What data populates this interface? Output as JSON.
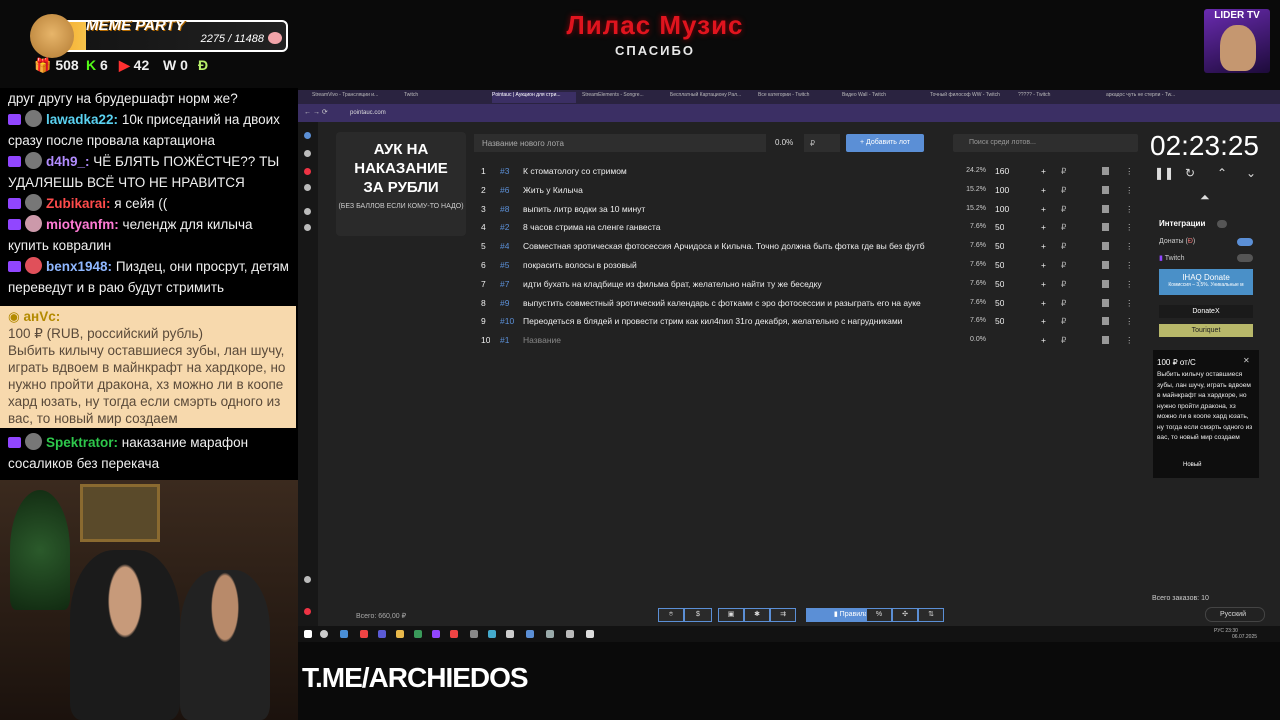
{
  "banner": {
    "title": "Лилас Музис",
    "subtitle": "СПАСИБО"
  },
  "meme_party": {
    "title": "MEME PARTY",
    "count": "2275 / 11488",
    "progress": 0.198
  },
  "stats": [
    {
      "icon": "gift-icon",
      "value": "508",
      "color": "#9146ff"
    },
    {
      "icon": "kick-icon",
      "value": "6",
      "color": "#53fc18"
    },
    {
      "icon": "youtube-icon",
      "value": "42",
      "color": "#ff3030"
    },
    {
      "icon": "w-icon",
      "value": "0",
      "color": "#ffffff"
    },
    {
      "icon": "donation-icon",
      "value": "",
      "color": "#b7f06a"
    }
  ],
  "chat": {
    "line0": "друг другу на брудершафт норм же?",
    "m1": {
      "nick": "lawadka22:",
      "text": "10к приседаний на двоих сразу после провала картациона",
      "color": "#5ad1f0"
    },
    "m2": {
      "nick": "d4h9_:",
      "text": "ЧЁ БЛЯТЬ ПОЖЁСТЧЕ?? ТЫ УДАЛЯЕШЬ ВСЁ ЧТО НЕ НРАВИТСЯ",
      "color": "#b28cff"
    },
    "m3": {
      "nick": "Zubikarai:",
      "text": "я сейя ((",
      "color": "#ff4b4b"
    },
    "m4": {
      "nick": "miotyanfm:",
      "text": "челендж для килыча купить коврaлин",
      "color": "#ff7bd5"
    },
    "m5": {
      "nick": "benx1948:",
      "text": "Пиздец, они просрут, детям переведут и в раю будут стримить",
      "color": "#8fb7ff"
    },
    "donation": {
      "nick": "aнVc:",
      "amount": "100 ₽",
      "currency": "(RUB, российский рубль)",
      "text": "Выбить килычу оставшиеся зубы, лан шучу, играть вдвоем в майнкрафт на хардкоре, но нужно пройти дракона, хз можно ли в коопе хард юзать, ну тогда если смэрть одного из вас, то новый мир создаем"
    },
    "m6": {
      "nick": "Spektrator:",
      "text": "наказание марафон сосаликов без перекача",
      "color": "#2ec74b"
    }
  },
  "browser": {
    "tabs": [
      "StreamVivo - Трансляции и...",
      "Twitch",
      "Pointauc | Аукцион для стри...",
      "StreamElements - Songre...",
      "Бесплатный Картациону Рал...",
      "Все категории - Twitch",
      "Видео Wall - Twitch",
      "Точный философ WW - Twitch",
      "????? - Twitch",
      "аркадос чуть не стерли - Tw..."
    ],
    "url": "pointauc.com"
  },
  "auction": {
    "title": "АУК НА\nНАКАЗАНИЕ\nЗА РУБЛИ",
    "subtitle": "(БЕЗ БАЛЛОВ ЕСЛИ КОМУ-ТО НАДО)",
    "new_lot_placeholder": "Название нового лота",
    "percent": "0.0%",
    "currency_input": "₽",
    "add_button": "Добавить лот",
    "search_placeholder": "Поиск среди лотов...",
    "lots": [
      {
        "num": "1",
        "id": "#3",
        "name": "К стоматологу со стримом",
        "pct": "24.2%",
        "amount": "160"
      },
      {
        "num": "2",
        "id": "#6",
        "name": "Жить у Килыча",
        "pct": "15.2%",
        "amount": "100"
      },
      {
        "num": "3",
        "id": "#8",
        "name": "выпить литр водки за 10 минут",
        "pct": "15.2%",
        "amount": "100"
      },
      {
        "num": "4",
        "id": "#2",
        "name": "8 часов стрима на сленге ганвеста",
        "pct": "7.6%",
        "amount": "50"
      },
      {
        "num": "5",
        "id": "#4",
        "name": "Совместная эротическая фотосессия Арчидоса и Килыча. Точно должна быть фотка где вы без футб",
        "pct": "7.6%",
        "amount": "50"
      },
      {
        "num": "6",
        "id": "#5",
        "name": "покрасить волосы в розовый",
        "pct": "7.6%",
        "amount": "50"
      },
      {
        "num": "7",
        "id": "#7",
        "name": "идти бухать на кладбище из фильма брат, желательно найти ту же беседку",
        "pct": "7.6%",
        "amount": "50"
      },
      {
        "num": "8",
        "id": "#9",
        "name": "выпустить совместный эротический календарь с фотками с эро фотосессии и разыграть его на ауке",
        "pct": "7.6%",
        "amount": "50"
      },
      {
        "num": "9",
        "id": "#10",
        "name": "Переодеться в блядей и провести стрим как кил4пил 31го декабря, желательно с нагрудниками",
        "pct": "7.6%",
        "amount": "50"
      },
      {
        "num": "10",
        "id": "#1",
        "name": "Название",
        "pct": "0.0%",
        "amount": ""
      }
    ],
    "total": "Всего: 660,00 ₽",
    "rules_button": "Правила",
    "timer": "02:23:25",
    "integrations_title": "Интеграции",
    "integ_donations": "Донаты (",
    "integ_twitch": "Twitch",
    "ihaq": "IHAQ Donate",
    "ihaq_sub": "Комиссия – 3,5%. Уникальные м",
    "donatex": "DonateX",
    "touriquet": "Touriquet",
    "donation_card_title": "100 ₽ от/С",
    "donation_card_text": "Выбить килычу оставшиеся зубы, лан шучу, играть вдвоем в майнкрафт на хардкоре, но нужно пройти дракона, хз можно ли в коопе хард юзать, ну тогда если смэрть одного из вас, то новый мир создаем",
    "donation_card_new": "Новый",
    "orders": "Всего заказов: 10",
    "language": "Русский"
  },
  "tray": {
    "lang": "РУС",
    "time": "23:30",
    "date": "06.07.2025"
  },
  "overlay": {
    "tme": "T.ME/ARCHIEDOS",
    "lider": "LIDER TV"
  }
}
